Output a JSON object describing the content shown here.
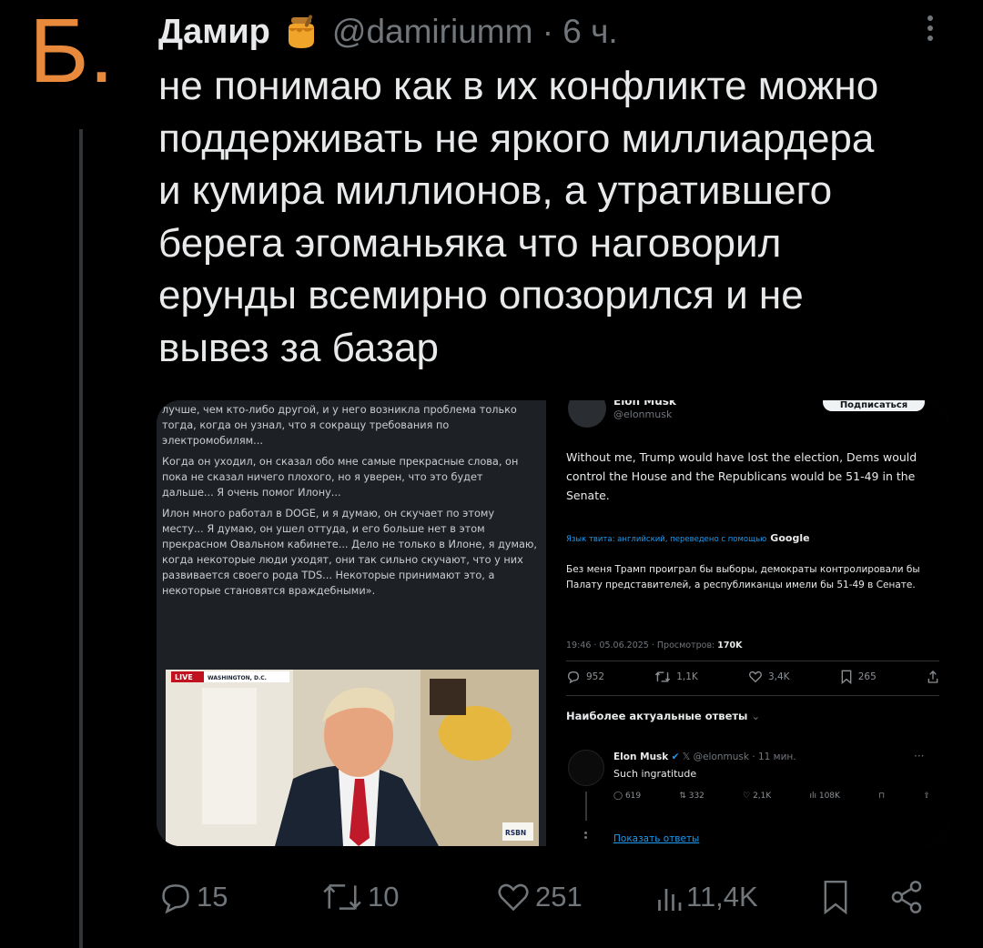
{
  "avatar": {
    "letter": "Б.",
    "color": "#e8893c"
  },
  "tweet": {
    "author": "Дамир",
    "emoji_icon": "honey-pot-icon",
    "handle_time": "@damiriumm · 6 ч.",
    "text": "не понимаю как в их конфликте можно\nподдерживать не яркого миллиардера\nи кумира миллионов, а утратившего\nберега эгоманьяка что наговорил\nерунды всемирно опозорился и не\nвывез за базар"
  },
  "media": {
    "left": {
      "paragraphs": [
        "лучше, чем кто-либо другой, и у него возникла проблема только тогда, когда он узнал, что я сокращу требования по электромобилям...",
        "Когда он уходил, он сказал обо мне самые прекрасные слова, он пока не сказал ничего плохого, но я уверен, что это будет дальше... Я очень помог Илону...",
        "Илон много работал в DOGE, и я думаю, он скучает по этому месту... Я думаю, он ушел оттуда, и его больше нет в этом прекрасном Овальном кабинете... Дело не только в Илоне, я думаю, когда некоторые люди уходят, они так сильно скучают, что у них развивается своего рода TDS... Некоторые принимают это, а некоторые становятся враждебными»."
      ],
      "live_badge": "LIVE",
      "location": "WASHINGTON, D.C.",
      "watermark": "RSBN"
    },
    "right": {
      "name": "Elon Musk",
      "handle": "@elonmusk",
      "subscribe": "Подписаться",
      "text_en": "Without me, Trump would have lost the election, Dems would control the House and the Republicans would be 51-49 in the Senate.",
      "lang_note": "Язык твита: английский, переведено с помощью",
      "google": "Google",
      "text_ru": "Без меня Трамп проиграл бы выборы, демократы контролировали бы Палату представителей, а республиканцы имели бы 51-49 в Сенате.",
      "meta": "19:46 · 05.06.2025 · Просмотров:",
      "views": "170K",
      "stats": {
        "replies": "952",
        "retweets": "1,1K",
        "likes": "3,4K",
        "bookmarks": "265"
      },
      "best_replies": "Наиболее актуальные ответы",
      "reply": {
        "name": "Elon Musk",
        "handle_time": "@elonmusk · 11 мин.",
        "text": "Such ingratitude",
        "stats": {
          "replies": "619",
          "retweets": "332",
          "likes": "2,1K",
          "views": "108K"
        },
        "show_replies": "Показать ответы"
      }
    }
  },
  "actions": {
    "replies": "15",
    "retweets": "10",
    "likes": "251",
    "views": "11,4K"
  }
}
